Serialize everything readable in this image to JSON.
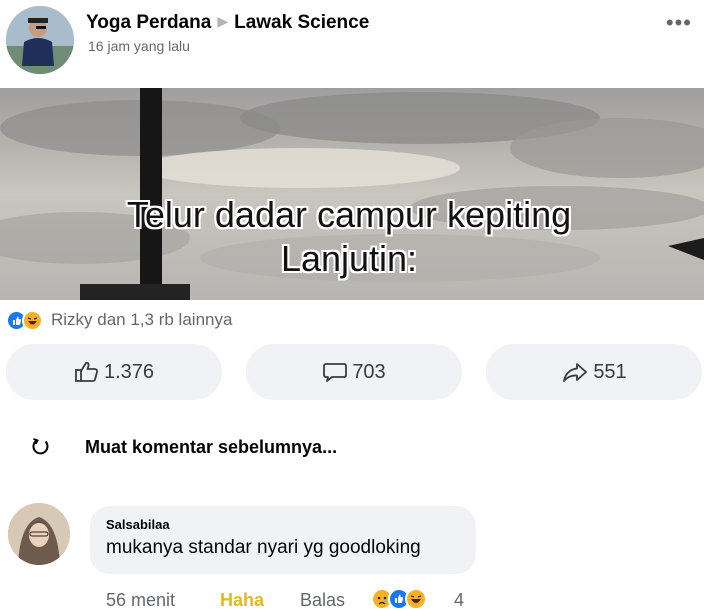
{
  "post": {
    "author": "Yoga Perdana",
    "group": "Lawak Science",
    "time": "16 jam yang lalu",
    "more_label": "•••",
    "caption_line1": "Telur dadar campur kepiting",
    "caption_line2": "Lanjutin:"
  },
  "reactions": {
    "icons": [
      "like-icon",
      "haha-icon"
    ],
    "summary": "Rizky dan 1,3 rb lainnya"
  },
  "actions": {
    "like_count": "1.376",
    "comment_count": "703",
    "share_count": "551"
  },
  "load_more": {
    "label": "Muat komentar sebelumnya..."
  },
  "comment": {
    "author": "Salsabilaa",
    "text": "mukanya standar nyari yg goodloking",
    "time": "56 menit",
    "reaction_label": "Haha",
    "reply_label": "Balas",
    "reaction_icons": [
      "sad-icon",
      "like-icon",
      "haha-icon"
    ],
    "reaction_count": "4"
  },
  "colors": {
    "like_blue": "#1877f2",
    "haha_yellow": "#f7b125",
    "button_bg": "#f0f2f5",
    "secondary_text": "#65676b"
  }
}
